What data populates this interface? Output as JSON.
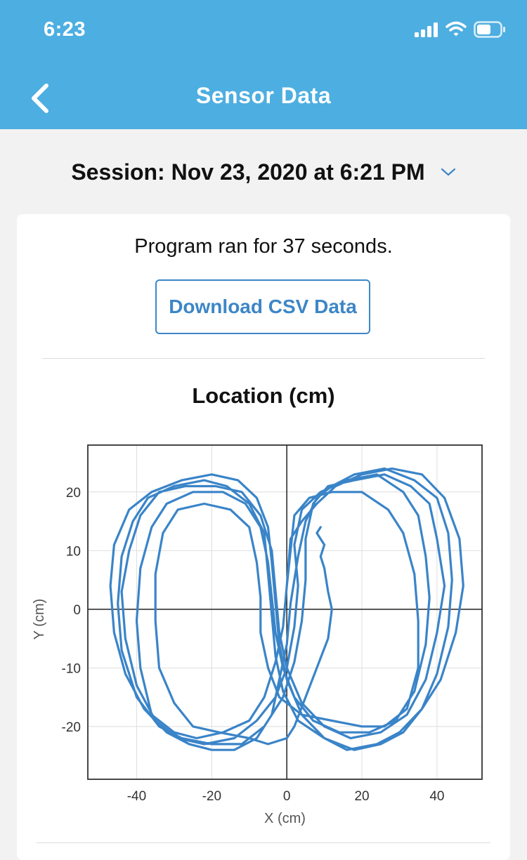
{
  "status_bar": {
    "time": "6:23"
  },
  "header": {
    "title": "Sensor Data"
  },
  "session": {
    "label": "Session: Nov 23, 2020 at 6:21 PM"
  },
  "summary": {
    "runtime_text": "Program ran for 37 seconds."
  },
  "actions": {
    "download_label": "Download CSV Data"
  },
  "colors": {
    "header": "#4daee1",
    "accent": "#3d86c6",
    "series": "#3a84c8"
  },
  "chart_data": {
    "type": "line",
    "title": "Location (cm)",
    "xlabel": "X (cm)",
    "ylabel": "Y (cm)",
    "xlim": [
      -53,
      52
    ],
    "ylim": [
      -29,
      28
    ],
    "xticks": [
      -40,
      -20,
      0,
      20,
      40
    ],
    "yticks": [
      -20,
      -10,
      0,
      10,
      20
    ],
    "grid": true,
    "series": [
      {
        "values": [
          [
            9,
            14
          ],
          [
            8,
            13
          ],
          [
            10,
            11
          ],
          [
            9,
            9
          ],
          [
            10,
            7
          ],
          [
            11,
            3
          ],
          [
            12,
            0
          ],
          [
            11,
            -5
          ],
          [
            8,
            -10
          ],
          [
            5,
            -15
          ],
          [
            2,
            -20
          ],
          [
            0,
            -22
          ],
          [
            -5,
            -23
          ],
          [
            -10,
            -22
          ],
          [
            -18,
            -21
          ],
          [
            -25,
            -20
          ],
          [
            -30,
            -16
          ],
          [
            -34,
            -10
          ],
          [
            -35,
            -2
          ],
          [
            -35,
            6
          ],
          [
            -33,
            13
          ],
          [
            -29,
            17
          ],
          [
            -22,
            18
          ],
          [
            -15,
            17
          ],
          [
            -10,
            14
          ],
          [
            -8,
            8
          ],
          [
            -7,
            2
          ],
          [
            -7,
            -4
          ],
          [
            -5,
            -10
          ],
          [
            -2,
            -15
          ],
          [
            4,
            -18
          ],
          [
            12,
            -19
          ],
          [
            20,
            -20
          ],
          [
            26,
            -20
          ],
          [
            32,
            -17
          ],
          [
            35,
            -10
          ],
          [
            35,
            -2
          ],
          [
            34,
            6
          ],
          [
            31,
            13
          ],
          [
            27,
            17
          ],
          [
            20,
            20
          ],
          [
            12,
            20
          ],
          [
            6,
            19
          ],
          [
            2,
            16
          ],
          [
            1,
            10
          ],
          [
            0,
            4
          ],
          [
            -1,
            -3
          ],
          [
            -3,
            -9
          ],
          [
            -6,
            -15
          ],
          [
            -10,
            -19
          ],
          [
            -17,
            -21
          ],
          [
            -24,
            -22
          ],
          [
            -30,
            -21
          ],
          [
            -36,
            -18
          ],
          [
            -39,
            -10
          ],
          [
            -40,
            -2
          ],
          [
            -39,
            7
          ],
          [
            -36,
            14
          ],
          [
            -32,
            18
          ],
          [
            -25,
            20
          ],
          [
            -17,
            20
          ],
          [
            -11,
            18
          ],
          [
            -7,
            14
          ],
          [
            -5,
            8
          ],
          [
            -4,
            2
          ],
          [
            -3,
            -4
          ],
          [
            -1,
            -10
          ],
          [
            2,
            -15
          ],
          [
            7,
            -19
          ],
          [
            14,
            -21
          ],
          [
            22,
            -21
          ],
          [
            29,
            -19
          ],
          [
            34,
            -14
          ],
          [
            37,
            -6
          ],
          [
            38,
            2
          ],
          [
            37,
            9
          ],
          [
            35,
            16
          ],
          [
            31,
            20
          ],
          [
            24,
            23
          ],
          [
            16,
            22
          ],
          [
            9,
            20
          ],
          [
            4,
            17
          ],
          [
            2,
            11
          ],
          [
            3,
            4
          ],
          [
            2,
            -3
          ],
          [
            0,
            -10
          ],
          [
            -3,
            -15
          ],
          [
            -8,
            -19
          ],
          [
            -14,
            -22
          ],
          [
            -22,
            -23
          ],
          [
            -29,
            -22
          ],
          [
            -35,
            -19
          ],
          [
            -40,
            -13
          ],
          [
            -43,
            -5
          ],
          [
            -44,
            3
          ],
          [
            -42,
            10
          ],
          [
            -39,
            16
          ],
          [
            -34,
            20
          ],
          [
            -27,
            21
          ],
          [
            -19,
            21
          ],
          [
            -12,
            20
          ],
          [
            -7,
            16
          ],
          [
            -4,
            10
          ],
          [
            -3,
            3
          ],
          [
            -2,
            -4
          ],
          [
            0,
            -10
          ],
          [
            4,
            -16
          ],
          [
            10,
            -20
          ],
          [
            17,
            -22
          ],
          [
            25,
            -21
          ],
          [
            32,
            -18
          ],
          [
            37,
            -12
          ],
          [
            40,
            -4
          ],
          [
            42,
            4
          ],
          [
            40,
            12
          ],
          [
            38,
            18
          ],
          [
            33,
            21
          ],
          [
            26,
            23
          ],
          [
            18,
            22
          ],
          [
            11,
            21
          ],
          [
            7,
            18
          ],
          [
            5,
            12
          ],
          [
            5,
            5
          ],
          [
            4,
            -2
          ],
          [
            2,
            -9
          ],
          [
            -1,
            -15
          ],
          [
            -6,
            -20
          ],
          [
            -12,
            -23
          ],
          [
            -20,
            -23
          ],
          [
            -28,
            -22
          ],
          [
            -34,
            -20
          ],
          [
            -40,
            -15
          ],
          [
            -44,
            -7
          ],
          [
            -45,
            1
          ],
          [
            -44,
            9
          ],
          [
            -41,
            15
          ],
          [
            -37,
            19
          ],
          [
            -30,
            21
          ],
          [
            -22,
            22
          ],
          [
            -16,
            21
          ],
          [
            -10,
            18
          ],
          [
            -6,
            13
          ],
          [
            -5,
            6
          ],
          [
            -4,
            -1
          ],
          [
            -3,
            -8
          ],
          [
            -1,
            -14
          ],
          [
            3,
            -19
          ],
          [
            10,
            -22
          ],
          [
            18,
            -24
          ],
          [
            25,
            -23
          ],
          [
            31,
            -21
          ],
          [
            36,
            -17
          ],
          [
            40,
            -11
          ],
          [
            43,
            -3
          ],
          [
            44,
            5
          ],
          [
            43,
            13
          ],
          [
            40,
            19
          ],
          [
            34,
            22
          ],
          [
            26,
            24
          ],
          [
            18,
            23
          ],
          [
            12,
            21
          ],
          [
            8,
            19
          ],
          [
            5,
            15
          ],
          [
            3,
            9
          ],
          [
            1,
            1
          ],
          [
            0,
            -6
          ],
          [
            -2,
            -12
          ],
          [
            -4,
            -18
          ],
          [
            -8,
            -22
          ],
          [
            -14,
            -24
          ],
          [
            -20,
            -24
          ],
          [
            -26,
            -23
          ],
          [
            -32,
            -21
          ],
          [
            -38,
            -17
          ],
          [
            -43,
            -11
          ],
          [
            -46,
            -4
          ],
          [
            -47,
            4
          ],
          [
            -46,
            11
          ],
          [
            -42,
            17
          ],
          [
            -36,
            20
          ],
          [
            -28,
            22
          ],
          [
            -20,
            23
          ],
          [
            -13,
            22
          ],
          [
            -8,
            19
          ],
          [
            -5,
            14
          ],
          [
            -4,
            8
          ],
          [
            -3,
            1
          ],
          [
            -2,
            -6
          ],
          [
            0,
            -12
          ],
          [
            4,
            -18
          ],
          [
            10,
            -22
          ],
          [
            16,
            -24
          ],
          [
            24,
            -23
          ],
          [
            30,
            -21
          ],
          [
            36,
            -17
          ],
          [
            41,
            -12
          ],
          [
            45,
            -4
          ],
          [
            47,
            4
          ],
          [
            46,
            12
          ],
          [
            42,
            19
          ],
          [
            36,
            23
          ],
          [
            28,
            24
          ],
          [
            20,
            23
          ],
          [
            13,
            21
          ],
          [
            8,
            18
          ],
          [
            4,
            15
          ],
          [
            1,
            12
          ],
          [
            0,
            4
          ]
        ]
      }
    ]
  }
}
